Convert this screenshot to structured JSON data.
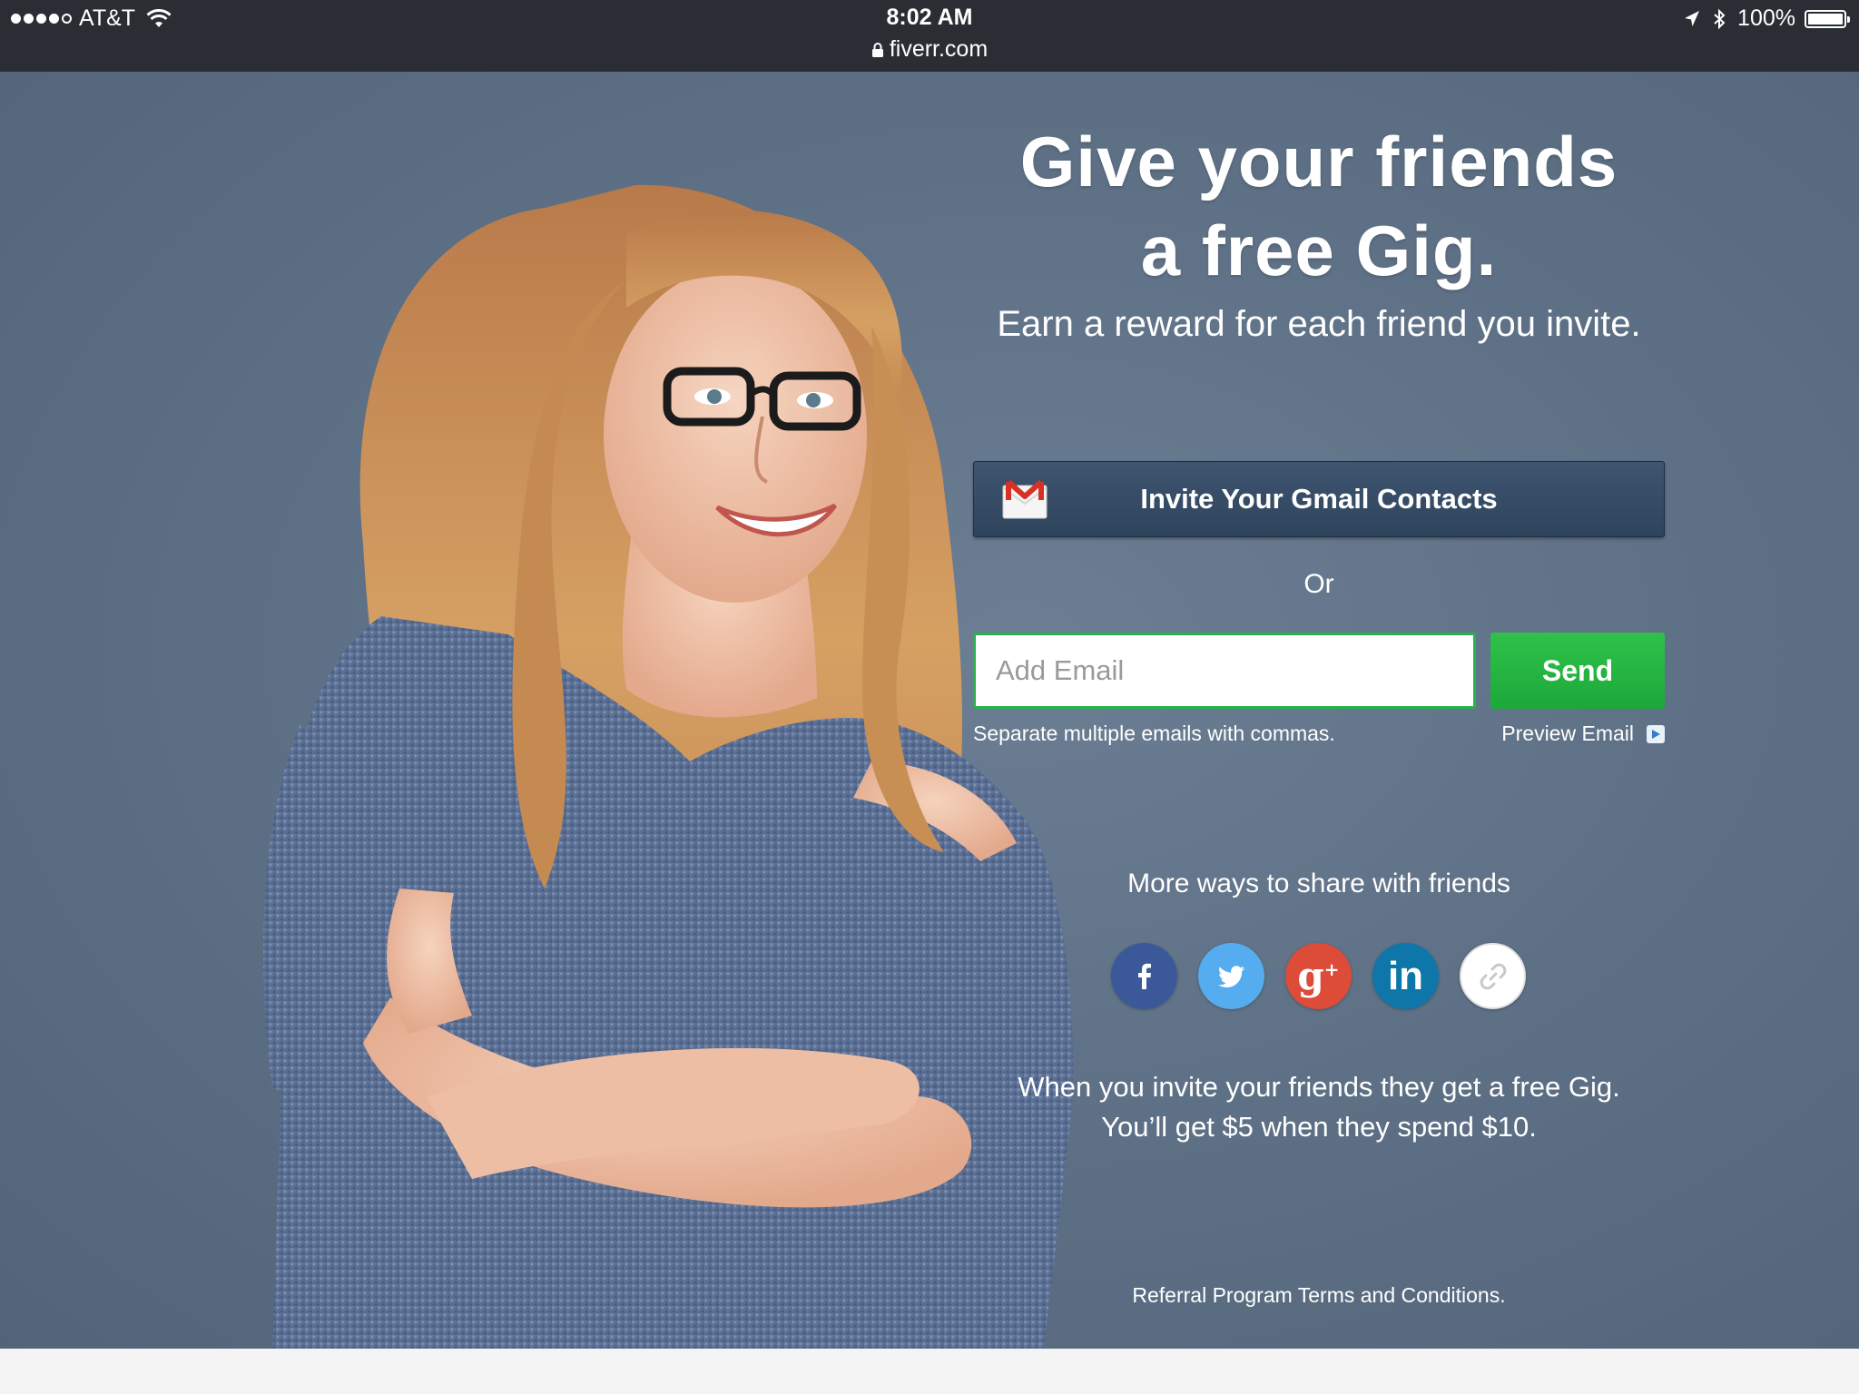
{
  "status_bar": {
    "carrier": "AT&T",
    "time": "8:02 AM",
    "url": "fiverr.com",
    "battery": "100%",
    "signal_bars_filled": 4,
    "signal_bars_total": 5
  },
  "hero": {
    "headline_line1": "Give your friends",
    "headline_line2": "a free Gig.",
    "subtitle": "Earn a reward for each friend you invite.",
    "gmail_button_label": "Invite Your Gmail Contacts",
    "or_text": "Or",
    "email_placeholder": "Add Email",
    "send_label": "Send",
    "helper_text": "Separate multiple emails with commas.",
    "preview_label": "Preview Email",
    "share_title": "More ways to share with friends",
    "share_buttons": [
      {
        "name": "facebook",
        "icon": "facebook-icon",
        "color": "#3b5998"
      },
      {
        "name": "twitter",
        "icon": "twitter-icon",
        "color": "#55acee"
      },
      {
        "name": "google-plus",
        "icon": "google-plus-icon",
        "color": "#dd4b39"
      },
      {
        "name": "linkedin",
        "icon": "linkedin-icon",
        "color": "#0e76a8"
      },
      {
        "name": "copy-link",
        "icon": "link-icon",
        "color": "#ffffff"
      }
    ],
    "reward_line1": "When you invite your friends they get a free Gig.",
    "reward_line2": "You’ll get $5 when they spend $10.",
    "terms_link": "Referral Program Terms and Conditions."
  },
  "colors": {
    "status_bar_bg": "#2a2e34",
    "hero_bg": "#5f7186",
    "gmail_button_bg": "#34495e",
    "send_green": "#1dbf3a",
    "input_border_green": "#27b34a"
  }
}
